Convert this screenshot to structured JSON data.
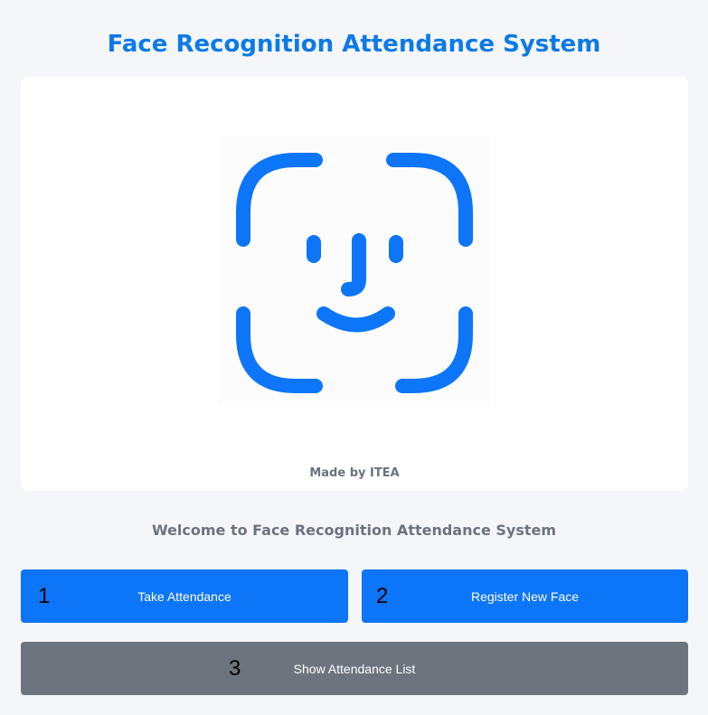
{
  "header": {
    "title": "Face Recognition Attendance System"
  },
  "card": {
    "logo_icon": "face-id-icon",
    "made_by": "Made by ITEA"
  },
  "welcome_text": "Welcome to Face Recognition Attendance System",
  "buttons": {
    "take_attendance": {
      "number": "1",
      "label": "Take Attendance"
    },
    "register_face": {
      "number": "2",
      "label": "Register New Face"
    },
    "show_list": {
      "number": "3",
      "label": "Show Attendance List"
    }
  },
  "colors": {
    "accent": "#0d7ae6",
    "primary_button": "#0d75f7",
    "secondary_button": "#6c757d",
    "muted_text": "#6b7380",
    "background": "#f4f6f9"
  }
}
